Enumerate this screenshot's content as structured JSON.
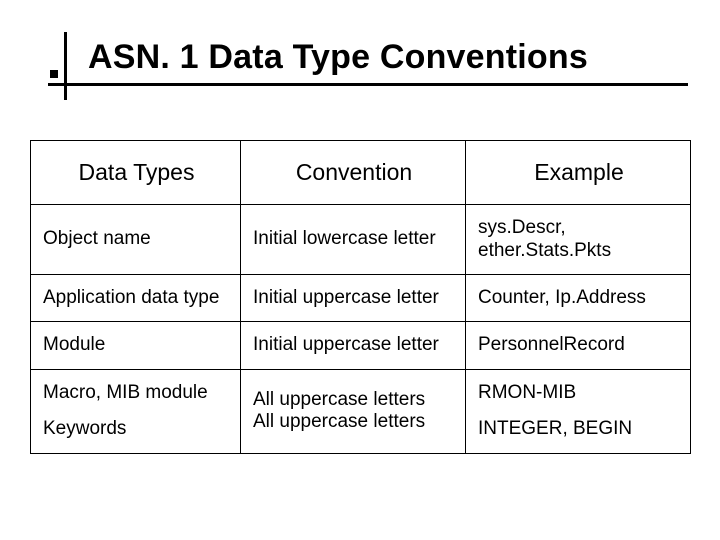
{
  "title": "ASN. 1 Data Type Conventions",
  "table": {
    "headers": [
      "Data Types",
      "Convention",
      "Example"
    ],
    "rows": [
      {
        "datatype": "Object name",
        "convention": "Initial lowercase letter",
        "example": "sys.Descr, ether.Stats.Pkts"
      },
      {
        "datatype": "Application data type",
        "convention": "Initial uppercase letter",
        "example": "Counter, Ip.Address"
      },
      {
        "datatype": "Module",
        "convention": "Initial uppercase letter",
        "example": "PersonnelRecord"
      },
      {
        "datatype": "Macro, MIB module",
        "convention": "All uppercase letters",
        "example": "RMON-MIB"
      },
      {
        "datatype": "Keywords",
        "convention": "All uppercase letters",
        "example": "INTEGER, BEGIN"
      }
    ]
  }
}
